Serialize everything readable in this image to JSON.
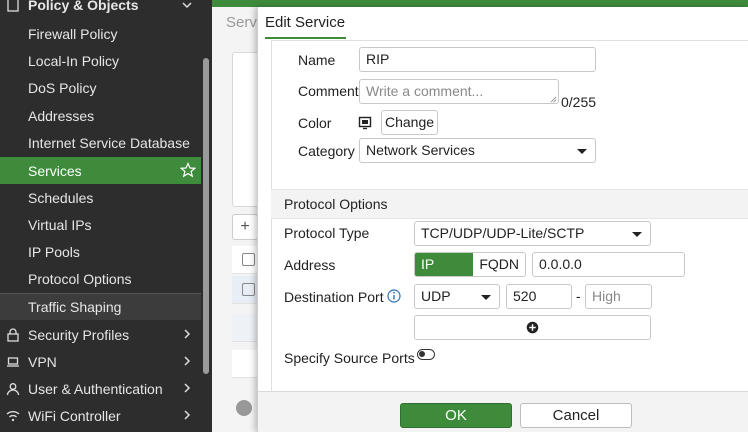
{
  "sidebar": {
    "header_label": "Policy & Objects",
    "items": [
      {
        "label": "Firewall Policy"
      },
      {
        "label": "Local-In Policy"
      },
      {
        "label": "DoS Policy"
      },
      {
        "label": "Addresses"
      },
      {
        "label": "Internet Service Database"
      },
      {
        "label": "Services"
      },
      {
        "label": "Schedules"
      },
      {
        "label": "Virtual IPs"
      },
      {
        "label": "IP Pools"
      },
      {
        "label": "Protocol Options"
      },
      {
        "label": "Traffic Shaping"
      }
    ],
    "sections": [
      {
        "label": "Security Profiles",
        "icon": "lock-icon"
      },
      {
        "label": "VPN",
        "icon": "laptop-icon"
      },
      {
        "label": "User & Authentication",
        "icon": "user-icon"
      },
      {
        "label": "WiFi Controller",
        "icon": "wifi-icon"
      }
    ],
    "active_color": "#3e8c3b"
  },
  "background_page": {
    "tab_label": "Servi"
  },
  "modal": {
    "title": "Edit Service",
    "name_label": "Name",
    "name_value": "RIP",
    "comments_label": "Comments",
    "comments_placeholder": "Write a comment...",
    "comments_counter": "0/255",
    "color_label": "Color",
    "color_change_label": "Change",
    "category_label": "Category",
    "category_value": "Network Services",
    "protocol_section_title": "Protocol Options",
    "protocol_type_label": "Protocol Type",
    "protocol_type_value": "TCP/UDP/UDP-Lite/SCTP",
    "address_label": "Address",
    "address_mode_iprange": "IP Range",
    "address_mode_fqdn": "FQDN",
    "address_value": "0.0.0.0",
    "destination_port_label": "Destination Port",
    "dest_protocol_value": "UDP",
    "dest_port_low": "520",
    "dest_port_separator": "-",
    "dest_port_high_placeholder": "High",
    "specify_source_ports_label": "Specify Source Ports",
    "specify_source_ports_enabled": false,
    "ok_label": "OK",
    "cancel_label": "Cancel"
  }
}
